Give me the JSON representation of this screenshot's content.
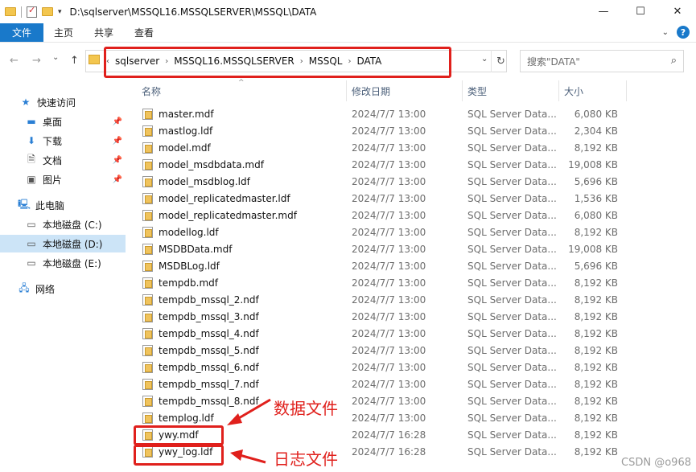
{
  "window": {
    "title": "D:\\sqlserver\\MSSQL16.MSSQLSERVER\\MSSQL\\DATA",
    "controls": [
      "—",
      "☐",
      "✕"
    ]
  },
  "ribbon": {
    "tabs": [
      "文件",
      "主页",
      "共享",
      "查看"
    ]
  },
  "nav": {
    "back": "←",
    "forward": "→",
    "recent": "⌄",
    "up": "↑"
  },
  "address": {
    "crumbs": [
      "sqlserver",
      "MSSQL16.MSSQLSERVER",
      "MSSQL",
      "DATA"
    ],
    "search_placeholder": "搜索\"DATA\""
  },
  "sidebar": {
    "quick_access": "快速访问",
    "items": [
      {
        "label": "桌面",
        "icon": "desktop-icon",
        "pinned": true
      },
      {
        "label": "下载",
        "icon": "download-icon",
        "pinned": true
      },
      {
        "label": "文档",
        "icon": "document-icon",
        "pinned": true
      },
      {
        "label": "图片",
        "icon": "picture-icon",
        "pinned": true
      }
    ],
    "this_pc": "此电脑",
    "drives": [
      {
        "label": "本地磁盘 (C:)"
      },
      {
        "label": "本地磁盘 (D:)",
        "selected": true
      },
      {
        "label": "本地磁盘 (E:)"
      }
    ],
    "network": "网络"
  },
  "columns": {
    "name": "名称",
    "date": "修改日期",
    "type": "类型",
    "size": "大小"
  },
  "files": [
    {
      "name": "master.mdf",
      "date": "2024/7/7 13:00",
      "type": "SQL Server Data...",
      "size": "6,080 KB"
    },
    {
      "name": "mastlog.ldf",
      "date": "2024/7/7 13:00",
      "type": "SQL Server Data...",
      "size": "2,304 KB"
    },
    {
      "name": "model.mdf",
      "date": "2024/7/7 13:00",
      "type": "SQL Server Data...",
      "size": "8,192 KB"
    },
    {
      "name": "model_msdbdata.mdf",
      "date": "2024/7/7 13:00",
      "type": "SQL Server Data...",
      "size": "19,008 KB"
    },
    {
      "name": "model_msdblog.ldf",
      "date": "2024/7/7 13:00",
      "type": "SQL Server Data...",
      "size": "5,696 KB"
    },
    {
      "name": "model_replicatedmaster.ldf",
      "date": "2024/7/7 13:00",
      "type": "SQL Server Data...",
      "size": "1,536 KB"
    },
    {
      "name": "model_replicatedmaster.mdf",
      "date": "2024/7/7 13:00",
      "type": "SQL Server Data...",
      "size": "6,080 KB"
    },
    {
      "name": "modellog.ldf",
      "date": "2024/7/7 13:00",
      "type": "SQL Server Data...",
      "size": "8,192 KB"
    },
    {
      "name": "MSDBData.mdf",
      "date": "2024/7/7 13:00",
      "type": "SQL Server Data...",
      "size": "19,008 KB"
    },
    {
      "name": "MSDBLog.ldf",
      "date": "2024/7/7 13:00",
      "type": "SQL Server Data...",
      "size": "5,696 KB"
    },
    {
      "name": "tempdb.mdf",
      "date": "2024/7/7 13:00",
      "type": "SQL Server Data...",
      "size": "8,192 KB"
    },
    {
      "name": "tempdb_mssql_2.ndf",
      "date": "2024/7/7 13:00",
      "type": "SQL Server Data...",
      "size": "8,192 KB"
    },
    {
      "name": "tempdb_mssql_3.ndf",
      "date": "2024/7/7 13:00",
      "type": "SQL Server Data...",
      "size": "8,192 KB"
    },
    {
      "name": "tempdb_mssql_4.ndf",
      "date": "2024/7/7 13:00",
      "type": "SQL Server Data...",
      "size": "8,192 KB"
    },
    {
      "name": "tempdb_mssql_5.ndf",
      "date": "2024/7/7 13:00",
      "type": "SQL Server Data...",
      "size": "8,192 KB"
    },
    {
      "name": "tempdb_mssql_6.ndf",
      "date": "2024/7/7 13:00",
      "type": "SQL Server Data...",
      "size": "8,192 KB"
    },
    {
      "name": "tempdb_mssql_7.ndf",
      "date": "2024/7/7 13:00",
      "type": "SQL Server Data...",
      "size": "8,192 KB"
    },
    {
      "name": "tempdb_mssql_8.ndf",
      "date": "2024/7/7 13:00",
      "type": "SQL Server Data...",
      "size": "8,192 KB"
    },
    {
      "name": "templog.ldf",
      "date": "2024/7/7 13:00",
      "type": "SQL Server Data...",
      "size": "8,192 KB"
    },
    {
      "name": "ywy.mdf",
      "date": "2024/7/7 16:28",
      "type": "SQL Server Data...",
      "size": "8,192 KB"
    },
    {
      "name": "ywy_log.ldf",
      "date": "2024/7/7 16:28",
      "type": "SQL Server Data...",
      "size": "8,192 KB"
    }
  ],
  "annotations": {
    "data_file": "数据文件",
    "log_file": "日志文件",
    "color": "#e0201c"
  },
  "watermark": "CSDN @o968"
}
